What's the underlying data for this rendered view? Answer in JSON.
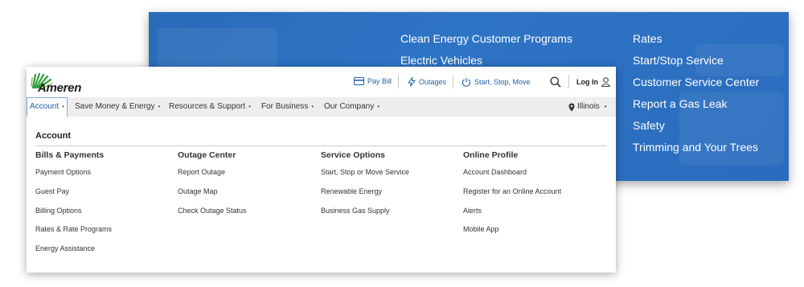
{
  "blue_menu": {
    "left_links": [
      "Clean Energy Customer Programs",
      "Electric Vehicles"
    ],
    "right_links": [
      "Rates",
      "Start/Stop Service",
      "Customer Service Center",
      "Report a Gas Leak",
      "Safety",
      "Trimming and Your Trees"
    ]
  },
  "header": {
    "logo_text": "Ameren",
    "pay_bill": "Pay Bill",
    "outages": "Outages",
    "start_stop_move": "Start, Stop, Move",
    "login": "Log In",
    "accent_color": "#1f5fa8"
  },
  "nav": {
    "items": [
      {
        "label": "Account",
        "active": true
      },
      {
        "label": "Save Money & Energy"
      },
      {
        "label": "Resources & Support"
      },
      {
        "label": "For Business"
      },
      {
        "label": "Our Company"
      }
    ],
    "dot": "•",
    "location": "Illinois"
  },
  "dropdown": {
    "title": "Account",
    "columns": [
      {
        "heading": "Bills & Payments",
        "links": [
          "Payment Options",
          "Guest Pay",
          "Billing Options",
          "Rates & Rate Programs",
          "Energy Assistance"
        ]
      },
      {
        "heading": "Outage Center",
        "links": [
          "Report Outage",
          "Outage Map",
          "Check Outage Status"
        ]
      },
      {
        "heading": "Service Options",
        "links": [
          "Start, Stop or Move Service",
          "Renewable Energy",
          "Business Gas Supply"
        ]
      },
      {
        "heading": "Online Profile",
        "links": [
          "Account Dashboard",
          "Register for an Online Account",
          "Alerts",
          "Mobile App"
        ]
      }
    ]
  }
}
